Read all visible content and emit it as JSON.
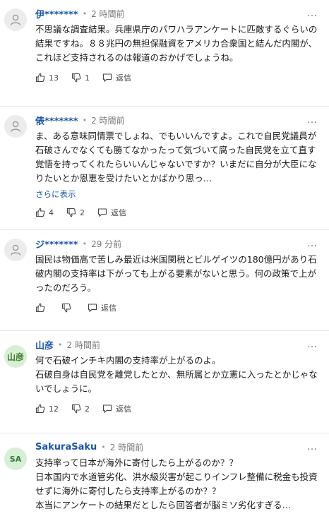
{
  "comments": [
    {
      "name": "伊*******",
      "time": "2 時間前",
      "text": "不思議な調査結果。兵庫県庁のパワハラアンケートに匹敵するぐらいの結果ですね。８８兆円の無担保融資をアメリカ合衆国と結んだ内閣が、これほど支持されるのは報道のおかげでしょうね。",
      "likes": "13",
      "dislikes": "1",
      "reply_label": "返信"
    },
    {
      "name": "俵*******",
      "time": "2 時間前",
      "text": "ま、ある意味同情票でしょね、でもいいんですよ。これで自民党議員が石破さんでなくても勝てなかったって気づいて腐った自民党を立て直す覚悟を持ってくれたらいいんじゃないですか？いまだに自分が大臣になりたいとか恩恵を受けたいとかばかり思っ…",
      "see_more": "さらに表示",
      "likes": "4",
      "dislikes": "2",
      "reply_label": "返信"
    },
    {
      "name": "ジ*******",
      "time": "29 分前",
      "text": "国民は物価高で苦しみ最近は米国関税とビルゲイツの180億円があり石破内閣の支持率は下がっても上がる要素がないと思う。何の政策で上がったのだろう。",
      "likes": "",
      "dislikes": "",
      "reply_label": "返信"
    },
    {
      "name": "山彦",
      "avatar_text": "山彦",
      "time": "2 時間前",
      "text": "何で石破インチキ内閣の支持率が上がるのよ。\n石破自身は自民党を離党したとか、無所属とか立憲に入ったとかじゃないでしょうに。",
      "likes": "12",
      "dislikes": "2",
      "reply_label": "返信"
    },
    {
      "name": "SakuraSaku",
      "avatar_text": "SA",
      "time": "2 時間前",
      "text": "支持率って日本が海外に寄付したら上がるのか？？\n日本国内で水道管劣化、洪水級災害が起こりインフレ整備に税金も投資せずに海外に寄付したら支持率上がるのか？？\n本当にアンケートの結果だとしたら回答者が脳ミソ劣化すぎる…"
    }
  ],
  "dot": "•",
  "more_icon": "…"
}
